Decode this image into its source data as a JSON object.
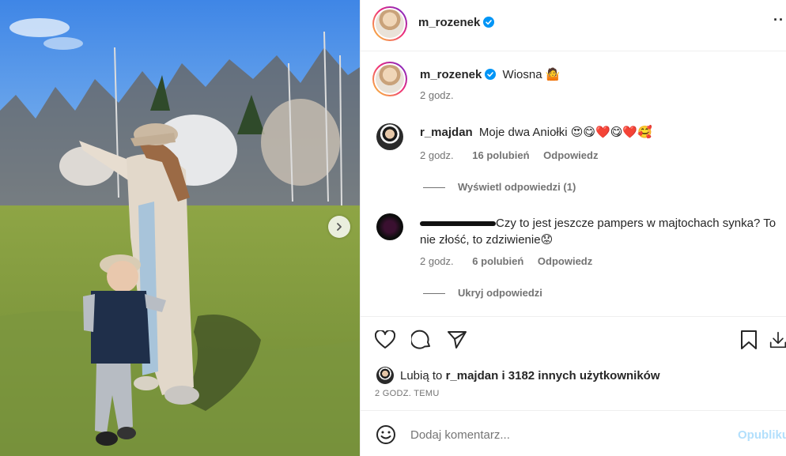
{
  "post": {
    "author": "m_rozenek",
    "caption": "Wiosna",
    "caption_emoji": "🤷",
    "time": "2 godz.",
    "more_glyph": "··"
  },
  "comments": [
    {
      "user": "r_majdan",
      "text": "Moje dwa Aniołki",
      "emojis": "😍😋❤️😋❤️🥰",
      "time": "2 godz.",
      "likes": "16 polubień",
      "reply": "Odpowiedz",
      "toggle": "Wyświetl odpowiedzi (1)"
    },
    {
      "user": "",
      "text": "Czy to jest jeszcze pampers w majtochach synka? To nie złość, to zdziwienie",
      "emojis": "😟",
      "time": "2 godz.",
      "likes": "6 polubień",
      "reply": "Odpowiedz",
      "toggle": "Ukryj odpowiedzi"
    }
  ],
  "likes_line": {
    "prefix": "Lubią to",
    "user": "r_majdan",
    "suffix": "i 3182 innych użytkowników",
    "time": "2 GODZ. TEMU"
  },
  "composer": {
    "placeholder": "Dodaj komentarz...",
    "publish": "Opublikuj"
  },
  "icons": [
    "heart-icon",
    "comment-icon",
    "share-icon",
    "bookmark-icon",
    "download-icon",
    "emoji-icon",
    "chevron-right-icon",
    "more-icon",
    "verified-icon"
  ],
  "colors": {
    "verified": "#0095f6",
    "publish": "#b2dffc",
    "muted": "#737373"
  }
}
